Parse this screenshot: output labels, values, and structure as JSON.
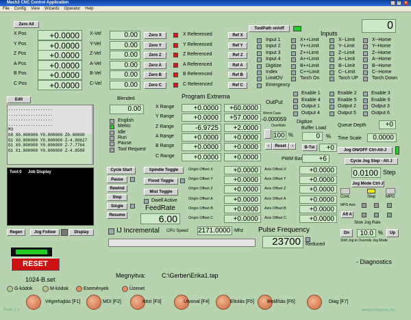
{
  "window": {
    "title": "Mach3 CNC Control Application",
    "min": "_",
    "max": "□",
    "close": "x"
  },
  "menu": [
    "File",
    "Config",
    "View",
    "Wizards",
    "Operator",
    "Help"
  ],
  "zero_all": "Zero All",
  "axes": [
    {
      "label": "X Pos",
      "value": "+0.0000",
      "vel_label": "X-Vel",
      "vel": "0.00",
      "zero": "Zero X",
      "ref_label": "X Referenced",
      "ref_btn": "Ref X"
    },
    {
      "label": "Y Pos",
      "value": "+0.0000",
      "vel_label": "Y-Vel",
      "vel": "0.00",
      "zero": "Zero Y",
      "ref_label": "Y Referenced",
      "ref_btn": "Ref Y"
    },
    {
      "label": "Z Pos",
      "value": "+0.0000",
      "vel_label": "Z-Vel",
      "vel": "0.00",
      "zero": "Zero Z",
      "ref_label": "Z Referenced",
      "ref_btn": "Ref Z"
    },
    {
      "label": "A Pos",
      "value": "+0.0000",
      "vel_label": "A-Vel",
      "vel": "0.00",
      "zero": "Zero A",
      "ref_label": "A Referenced",
      "ref_btn": "Ref A"
    },
    {
      "label": "B Pos",
      "value": "+0.0000",
      "vel_label": "B-Vel",
      "vel": "0.00",
      "zero": "Zero B",
      "ref_label": "B Referenced",
      "ref_btn": "Ref B"
    },
    {
      "label": "C Pos",
      "value": "+0.0000",
      "vel_label": "C-Vel",
      "vel": "0.00",
      "zero": "Zero C",
      "ref_label": "C Referenced",
      "ref_btn": "Ref C"
    }
  ],
  "toolpath_btn": "ToolPath on/off",
  "inputs_title": "Inputs",
  "counter": "0",
  "inputs_col1": [
    "Input 1",
    "Input 2",
    "Input 3",
    "Input 4",
    "Digitize",
    "Index",
    "LimitOV",
    "Emergency"
  ],
  "inputs_col2": [
    "X++Limit",
    "Y++Limit",
    "Z++Limit",
    "A++Limit",
    "B++Limit",
    "C++Limit",
    "Torch On"
  ],
  "inputs_col3": [
    "X--Limit",
    "Y--Limit",
    "Z--Limit",
    "A--Limit",
    "B--Limit",
    "C--Limit",
    "Torch UP"
  ],
  "inputs_col4": [
    "X--Home",
    "Y--Home",
    "Z--Home",
    "A--Home",
    "B--Home",
    "C--Home",
    "Torch Down"
  ],
  "edit_btn": "Edit",
  "gcode_lines": [
    "..................",
    "..................",
    "..................",
    "..................",
    "M3",
    "G0 X0.000000 Y0.000000 Z0.00000",
    "G1 X0.000000 Y0.000000 Z-4.88627",
    "G1 X0.000000 Y0.000000 Z-7.7764",
    "G1 X1.000000 Y0.000000 Z-4.8588"
  ],
  "blended": {
    "label": "Blended",
    "value": "0.00"
  },
  "modes": [
    "English",
    "Metric",
    "Idle",
    "Run",
    "Pause",
    "Tool Request"
  ],
  "prog_extrema": "Program Extrema",
  "ranges": [
    {
      "label": "X Range",
      "min": "+0.0000",
      "max": "+60.0000"
    },
    {
      "label": "Y Range",
      "min": "+0.0000",
      "max": "+57.0000"
    },
    {
      "label": "Z Range",
      "min": "-6.9725",
      "max": "+2.0000"
    },
    {
      "label": "A Range",
      "min": "+0.0000",
      "max": "+0.0000"
    },
    {
      "label": "B Range",
      "min": "+0.0000",
      "max": "+0.0000"
    },
    {
      "label": "C Range",
      "min": "+0.0000",
      "max": "+0.0000"
    }
  ],
  "output": {
    "title": "OutPut",
    "worst_label": "Worst Case",
    "worst": "-0.000059",
    "override": "OverRide",
    "pct": "100",
    "pct_sym": "%",
    "reset": "Reset"
  },
  "enables": {
    "col1": [
      "Enable 1",
      "Enable 4",
      "Output 1",
      "Output 4"
    ],
    "col2": [
      "Enable 2",
      "Enable 5",
      "Output 2",
      "Output 5"
    ],
    "col3": [
      "Enable 3",
      "Enable 6",
      "Output 3",
      "Output 6"
    ]
  },
  "digitize": "Digitize",
  "buffer_load": "Buffer Load",
  "buffer_val": "0",
  "buffer_pct": "%",
  "btst": "B-Tst",
  "btst_val": "+0",
  "pwm_label": "PWM Base",
  "pwm": "+6",
  "queue_label": "Queue Depth",
  "queue": "+0",
  "timescale_label": "Time Scale",
  "timescale": "0.0000",
  "jog_onoff": "Jog ON/OFF Ctrl-Alt-J",
  "cycle_jog": "Cycle Jog Step - Alt J",
  "jog_step": "0.0100",
  "step_label": "Step",
  "jog_mode": "Jog Mode Ctrl-J",
  "cont": "Cont.",
  "step2": "Step",
  "mpg": "MPG",
  "mpg_axis": "MPG Axis",
  "alt_a": "Alt A",
  "slow_jog": "Slow Jog Rate",
  "dn": "Dn",
  "jog_pct": "10.0",
  "jog_pct_sym": "%",
  "up": "Up",
  "shift_hint": "Shift Jog to Override Jog Mode",
  "toolpath": {
    "label": "Tool:0",
    "display": "Job Display"
  },
  "regen": "Regen",
  "jog_follow": "Jog Follow",
  "display": "Display",
  "buttons": {
    "cycle_start": "Cycle Start",
    "pause": "Pause",
    "rewind": "Rewind",
    "stop": "Stop",
    "single": "Single",
    "resume": "Resume"
  },
  "spindle_toggle": "Spindle Toggle",
  "flood_toggle": "Flood Toggle",
  "mist_toggle": "Mist Toggle",
  "dwell": "Dwell Active",
  "feedrate": {
    "label": "FeedRate",
    "value": "6.00"
  },
  "origins": [
    {
      "label": "Origin Offset X",
      "value": "+0.0000",
      "axis": "Axis Offset X",
      "axis_val": "+0.0000"
    },
    {
      "label": "Origin Offset Y",
      "value": "+0.0000",
      "axis": "Axis Offset Y",
      "axis_val": "+0.0000"
    },
    {
      "label": "Origin Offset Z",
      "value": "+0.0000",
      "axis": "Axis Offset Z",
      "axis_val": "+0.0000"
    },
    {
      "label": "Origin Offset A",
      "value": "+0.0000",
      "axis": "Axis Offset A",
      "axis_val": "+0.0000"
    },
    {
      "label": "Origin Offset B",
      "value": "+0.0000",
      "axis": "Axis Offset B",
      "axis_val": "+0.0000"
    },
    {
      "label": "Origin Offset C",
      "value": "+0.0000",
      "axis": "Axis Offset C",
      "axis_val": "+0.0000"
    }
  ],
  "ij": "IJ Incremental",
  "cpu_label": "CPU Speed",
  "cpu": "2171.0000",
  "mhz": "Mhz",
  "pulse_label": "Pulse Frequency",
  "pulse": "23700",
  "reduced": "Reduced",
  "diagnostics": "- Diagnostics",
  "reset_btn": "RESET",
  "version": "1024-B.set",
  "megnyitva_label": "Megnyitva:",
  "megnyitva": "C:\\Gerber\\Erika1.tap",
  "legend": [
    "G-kódok",
    "M-kódok",
    "Események",
    "Üzenet"
  ],
  "bottom_tabs": [
    "Végrehajtás [F1]",
    "MDI [F2]",
    "Kézi [F3]",
    "Útvonal [F4]",
    "Eltolás [F5]",
    "Beállítás [F6]",
    "Diag [F7]"
  ],
  "profile": "Profil 2.1",
  "website": "www.hobbycnc.hu",
  "colors": {
    "bg": "#b7d3b0",
    "dro": "#cde8c6",
    "led_red": "#cc1f1f",
    "led_green": "#22cc22",
    "reset": "#cc1111",
    "tab": "#c8663a"
  }
}
